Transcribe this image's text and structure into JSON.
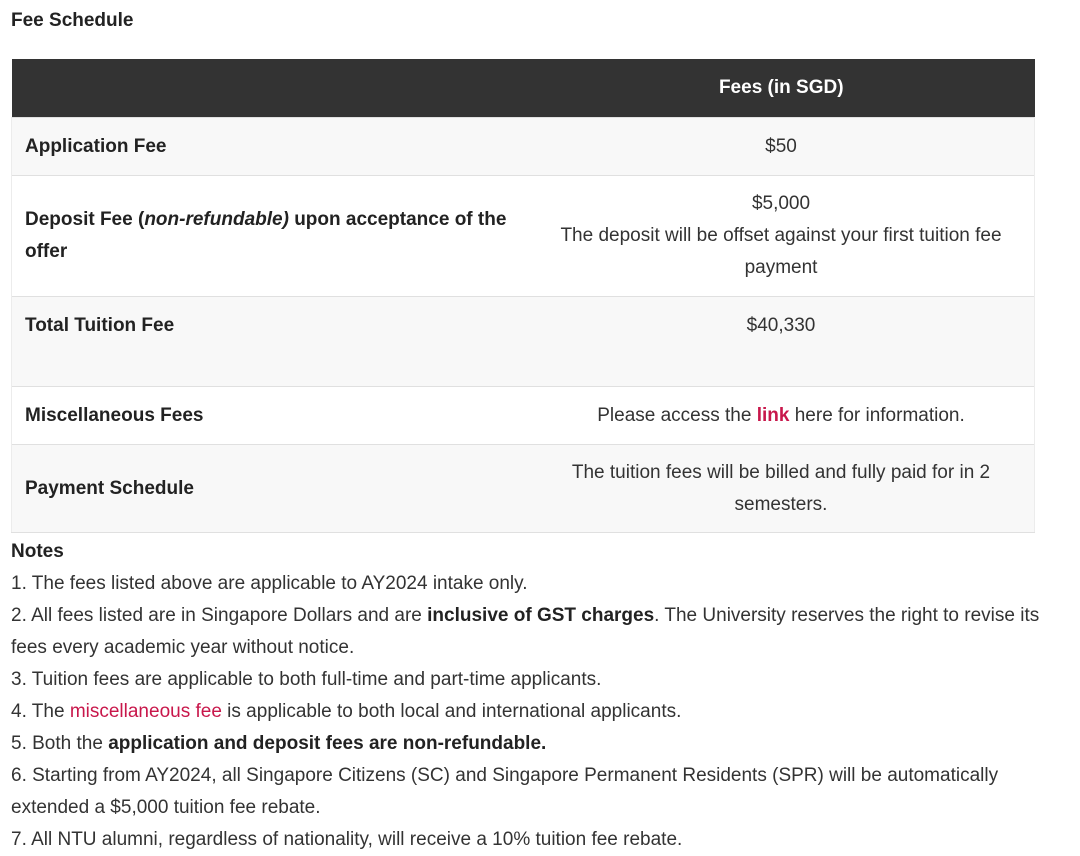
{
  "title": "Fee Schedule",
  "table": {
    "header": "Fees (in SGD)",
    "rows": [
      {
        "label": "Application Fee",
        "value": "$50"
      },
      {
        "label_start": "Deposit Fee (",
        "label_italic": "non-refundable)",
        "label_end": " upon acceptance of the offer",
        "value": "$5,000",
        "value_note": "The deposit will be offset against your first tuition fee payment"
      },
      {
        "label": "Total Tuition Fee",
        "value": "$40,330"
      },
      {
        "label": "Miscellaneous Fees",
        "value_before": "Please access the ",
        "value_link": "link",
        "value_after": " here for information."
      },
      {
        "label": "Payment Schedule",
        "value": "The tuition fees will be billed and fully paid for in 2 semesters."
      }
    ]
  },
  "notes": {
    "title": "Notes",
    "n1": "1. The fees listed above are applicable to AY2024 intake only.",
    "n2_before": "2. All fees listed are in Singapore Dollars and are ",
    "n2_bold": "inclusive of GST charges",
    "n2_after": ". The University reserves the right to revise its fees every academic year without notice.",
    "n3": "3. Tuition fees are applicable to both full-time and part-time applicants.",
    "n4_before": "4. The ",
    "n4_link": "miscellaneous fee",
    "n4_after": " is applicable to both local and international applicants.",
    "n5_before": "5. Both the ",
    "n5_bold": "application and deposit fees are non-refundable.",
    "n6": "6. Starting from AY2024, all Singapore Citizens (SC) and Singapore Permanent Residents (SPR) will be automatically extended a $5,000 tuition fee rebate.",
    "n7": "7. All NTU alumni, regardless of nationality, will receive a 10% tuition fee rebate."
  },
  "colors": {
    "header_bg": "#333333",
    "link": "#c8174b"
  }
}
